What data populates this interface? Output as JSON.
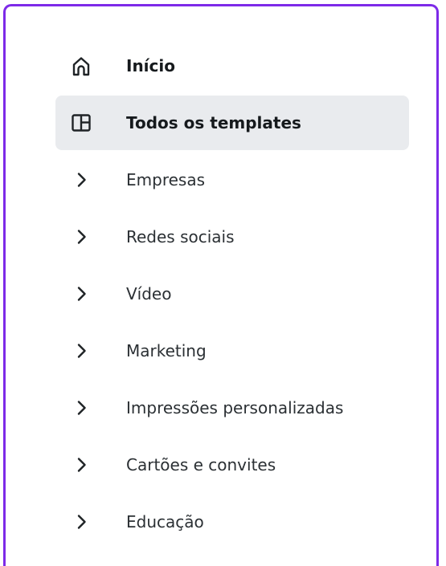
{
  "nav": {
    "items": [
      {
        "label": "Início",
        "icon": "home-icon"
      },
      {
        "label": "Todos os templates",
        "icon": "template-layout-icon"
      },
      {
        "label": "Empresas",
        "icon": "chevron-right-icon"
      },
      {
        "label": "Redes sociais",
        "icon": "chevron-right-icon"
      },
      {
        "label": "Vídeo",
        "icon": "chevron-right-icon"
      },
      {
        "label": "Marketing",
        "icon": "chevron-right-icon"
      },
      {
        "label": "Impressões personalizadas",
        "icon": "chevron-right-icon"
      },
      {
        "label": "Cartões e convites",
        "icon": "chevron-right-icon"
      },
      {
        "label": "Educação",
        "icon": "chevron-right-icon"
      }
    ],
    "selected_label": "Todos os templates"
  },
  "colors": {
    "frame_border": "#7d2ae8",
    "selected_bg": "#e9ebee",
    "text": "#2b3034",
    "icon": "#1f2326"
  }
}
